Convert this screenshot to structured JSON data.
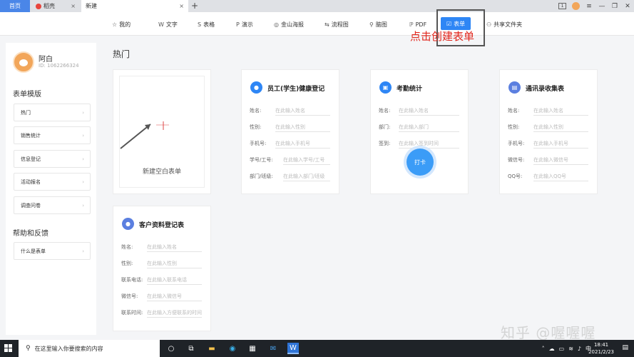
{
  "tabs": {
    "home": "首页",
    "daoke": "稻壳",
    "new": "新建",
    "close_glyph": "×",
    "plus_glyph": "+"
  },
  "window": {
    "badge": "1"
  },
  "toolbar": {
    "items": [
      {
        "label": "我的",
        "icon": "star-icon"
      },
      {
        "label": "文字",
        "icon": "word-icon"
      },
      {
        "label": "表格",
        "icon": "sheet-icon"
      },
      {
        "label": "演示",
        "icon": "ppt-icon"
      },
      {
        "label": "金山海报",
        "icon": "poster-icon"
      },
      {
        "label": "流程图",
        "icon": "flow-icon"
      },
      {
        "label": "脑图",
        "icon": "mindmap-icon"
      },
      {
        "label": "PDF",
        "icon": "pdf-icon"
      },
      {
        "label": "表单",
        "icon": "form-icon"
      },
      {
        "label": "共享文件夹",
        "icon": "share-icon"
      }
    ],
    "annotation": "点击创建表单"
  },
  "sidebar": {
    "user_name": "阿白",
    "user_id": "ID: 1062266324",
    "templates_title": "表单模版",
    "templates": [
      "热门",
      "销售统计",
      "信息登记",
      "活动报名",
      "调查问卷"
    ],
    "help_title": "帮助和反馈",
    "help_items": [
      "什么是表单"
    ],
    "chevron": "›"
  },
  "main": {
    "section_title": "热门",
    "blank_card": {
      "label": "新建空白表单"
    },
    "cards": [
      {
        "title": "员工(学生)健康登记",
        "fields": [
          {
            "label": "姓名:",
            "placeholder": "在此输入姓名"
          },
          {
            "label": "性别:",
            "placeholder": "在此输入性别"
          },
          {
            "label": "手机号:",
            "placeholder": "在此输入手机号"
          },
          {
            "label": "学号/工号:",
            "placeholder": "在此输入学号/工号"
          },
          {
            "label": "部门/班级:",
            "placeholder": "在此输入部门/班级"
          }
        ]
      },
      {
        "title": "考勤统计",
        "fields": [
          {
            "label": "姓名:",
            "placeholder": "在此输入姓名"
          },
          {
            "label": "部门:",
            "placeholder": "在此输入部门"
          },
          {
            "label": "签到:",
            "placeholder": "在此输入签到时间"
          }
        ],
        "button": "打卡"
      },
      {
        "title": "通讯录收集表",
        "fields": [
          {
            "label": "姓名:",
            "placeholder": "在此输入姓名"
          },
          {
            "label": "性别:",
            "placeholder": "在此输入性别"
          },
          {
            "label": "手机号:",
            "placeholder": "在此输入手机号"
          },
          {
            "label": "微信号:",
            "placeholder": "在此输入微信号"
          },
          {
            "label": "QQ号:",
            "placeholder": "在此输入QQ号"
          }
        ]
      },
      {
        "title": "客户资料登记表",
        "fields": [
          {
            "label": "姓名:",
            "placeholder": "在此输入姓名"
          },
          {
            "label": "性别:",
            "placeholder": "在此输入性别"
          },
          {
            "label": "联系电话:",
            "placeholder": "在此输入联系电话"
          },
          {
            "label": "微信号:",
            "placeholder": "在此输入微信号"
          },
          {
            "label": "联系时间:",
            "placeholder": "在此输入方便联系的时间"
          }
        ]
      }
    ]
  },
  "taskbar": {
    "search_placeholder": "在这里输入你要搜索的内容",
    "ime": "中",
    "time": "18:41",
    "date": "2021/2/23"
  },
  "watermark": "知乎 @喔喔喔"
}
